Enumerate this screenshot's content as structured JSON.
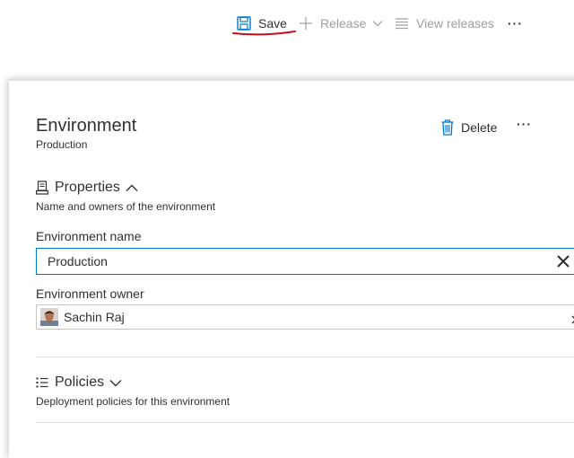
{
  "toolbar": {
    "save_label": "Save",
    "release_label": "Release",
    "view_releases_label": "View releases",
    "more_label": "···",
    "save_icon": "save-icon",
    "release_icon": "plus-icon",
    "view_releases_icon": "list-icon",
    "save_underline_color": "#c50f1f"
  },
  "panel": {
    "title": "Environment",
    "subtitle": "Production",
    "delete_label": "Delete",
    "delete_icon": "trash-icon",
    "more_label": "···"
  },
  "properties": {
    "title": "Properties",
    "description": "Name and owners of the environment",
    "icon": "properties-icon",
    "expanded": true,
    "name_label": "Environment name",
    "name_value": "Production",
    "owner_label": "Environment owner",
    "owner_name": "Sachin Raj"
  },
  "policies": {
    "title": "Policies",
    "description": "Deployment policies for this environment",
    "icon": "policies-icon",
    "expanded": false
  },
  "colors": {
    "accent": "#0078d4",
    "text": "#323130",
    "disabled_text": "#a19f9d",
    "divider": "#e1dfdd"
  }
}
